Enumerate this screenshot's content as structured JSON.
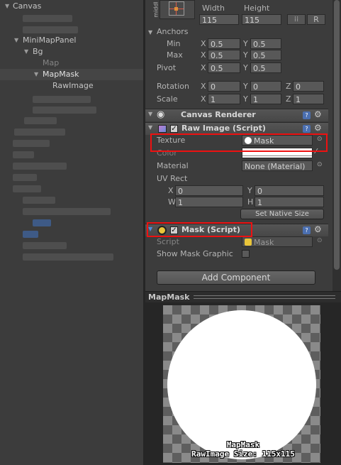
{
  "hierarchy": {
    "root": "Canvas",
    "minimap_panel": "MiniMapPanel",
    "bg": "Bg",
    "map": "Map",
    "mapmask": "MapMask",
    "rawimage": "RawImage"
  },
  "inspector": {
    "rect": {
      "anchor_preset_label": "middl",
      "width_label": "Width",
      "height_label": "Height",
      "width": "115",
      "height": "115",
      "raw_button": "R",
      "anchors_label": "Anchors",
      "min_label": "Min",
      "max_label": "Max",
      "pivot_label": "Pivot",
      "anchor_min_x": "0.5",
      "anchor_min_y": "0.5",
      "anchor_max_x": "0.5",
      "anchor_max_y": "0.5",
      "pivot_x": "0.5",
      "pivot_y": "0.5",
      "rotation_label": "Rotation",
      "rotation_x": "0",
      "rotation_y": "0",
      "rotation_z": "0",
      "scale_label": "Scale",
      "scale_x": "1",
      "scale_y": "1",
      "scale_z": "1",
      "x": "X",
      "y": "Y",
      "z": "Z"
    },
    "canvas_renderer": {
      "title": "Canvas Renderer"
    },
    "raw_image": {
      "title": "Raw Image (Script)",
      "texture_label": "Texture",
      "texture_value": "Mask",
      "color_label": "Color",
      "material_label": "Material",
      "material_value": "None (Material)",
      "uv_rect_label": "UV Rect",
      "uv_x": "0",
      "uv_y": "0",
      "uv_w": "1",
      "uv_h": "1",
      "w": "W",
      "h": "H",
      "set_native_size": "Set Native Size"
    },
    "mask": {
      "title": "Mask (Script)",
      "script_label": "Script",
      "script_value": "Mask",
      "show_mask_graphic_label": "Show Mask Graphic"
    },
    "add_component": "Add Component"
  },
  "preview": {
    "title": "MapMask",
    "name": "MapMask",
    "size_text": "RawImage Size: 115x115"
  },
  "colors": {
    "highlight_red": "#e11111",
    "selection": "#454545",
    "help_blue": "#4b6fb0"
  }
}
